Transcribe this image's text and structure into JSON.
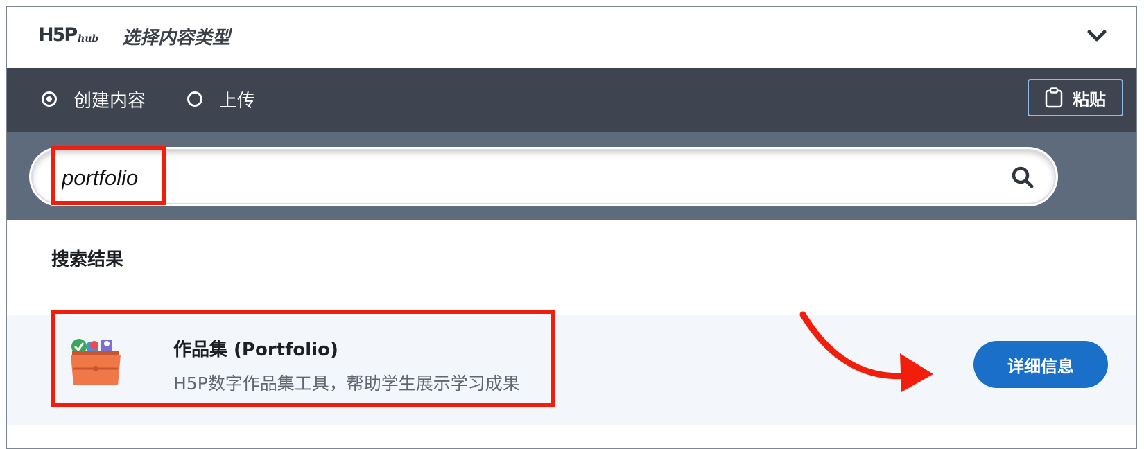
{
  "header": {
    "logo_main": "H5P",
    "logo_sub": "hub",
    "title": "选择内容类型"
  },
  "tabs": [
    {
      "label": "创建内容",
      "selected": true
    },
    {
      "label": "上传",
      "selected": false
    }
  ],
  "paste_button": {
    "label": "粘贴"
  },
  "search": {
    "value": "portfolio"
  },
  "results": {
    "heading": "搜索结果",
    "items": [
      {
        "title": "作品集 (Portfolio)",
        "description": "H5P数字作品集工具，帮助学生展示学习成果",
        "details_label": "详细信息"
      }
    ]
  },
  "colors": {
    "tabs_bg": "#3f4550",
    "search_bg": "#5d6b7c",
    "item_bg": "#f3f7fc",
    "primary_button": "#1a6fc9",
    "annotation_red": "#f01e0a"
  }
}
